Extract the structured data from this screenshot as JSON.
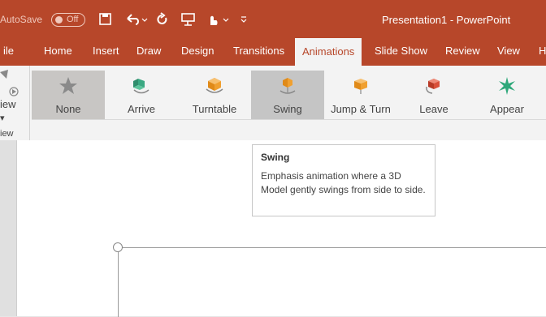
{
  "titlebar": {
    "autosave_label": "AutoSave",
    "autosave_state": "Off",
    "document_title": "Presentation1 - PowerPoint"
  },
  "tabs": [
    {
      "label": "ile"
    },
    {
      "label": "Home"
    },
    {
      "label": "Insert"
    },
    {
      "label": "Draw"
    },
    {
      "label": "Design"
    },
    {
      "label": "Transitions"
    },
    {
      "label": "Animations",
      "active": true
    },
    {
      "label": "Slide Show"
    },
    {
      "label": "Review"
    },
    {
      "label": "View"
    },
    {
      "label": "H"
    }
  ],
  "preview": {
    "button_label": "iew",
    "group_label": "iew"
  },
  "animations": [
    {
      "label": "None",
      "icon": "star-icon",
      "selected": true
    },
    {
      "label": "Arrive",
      "icon": "arrive-icon"
    },
    {
      "label": "Turntable",
      "icon": "turntable-icon"
    },
    {
      "label": "Swing",
      "icon": "swing-icon",
      "hovered": true
    },
    {
      "label": "Jump & Turn",
      "icon": "jump-turn-icon"
    },
    {
      "label": "Leave",
      "icon": "leave-icon"
    },
    {
      "label": "Appear",
      "icon": "appear-icon"
    }
  ],
  "tooltip": {
    "title": "Swing",
    "description": "Emphasis animation where a 3D Model gently swings from side to side."
  },
  "colors": {
    "brand": "#b7472a",
    "arrive": "#3aa882",
    "orange": "#f0a030",
    "leave": "#d9503a",
    "appear": "#2ea87a"
  }
}
